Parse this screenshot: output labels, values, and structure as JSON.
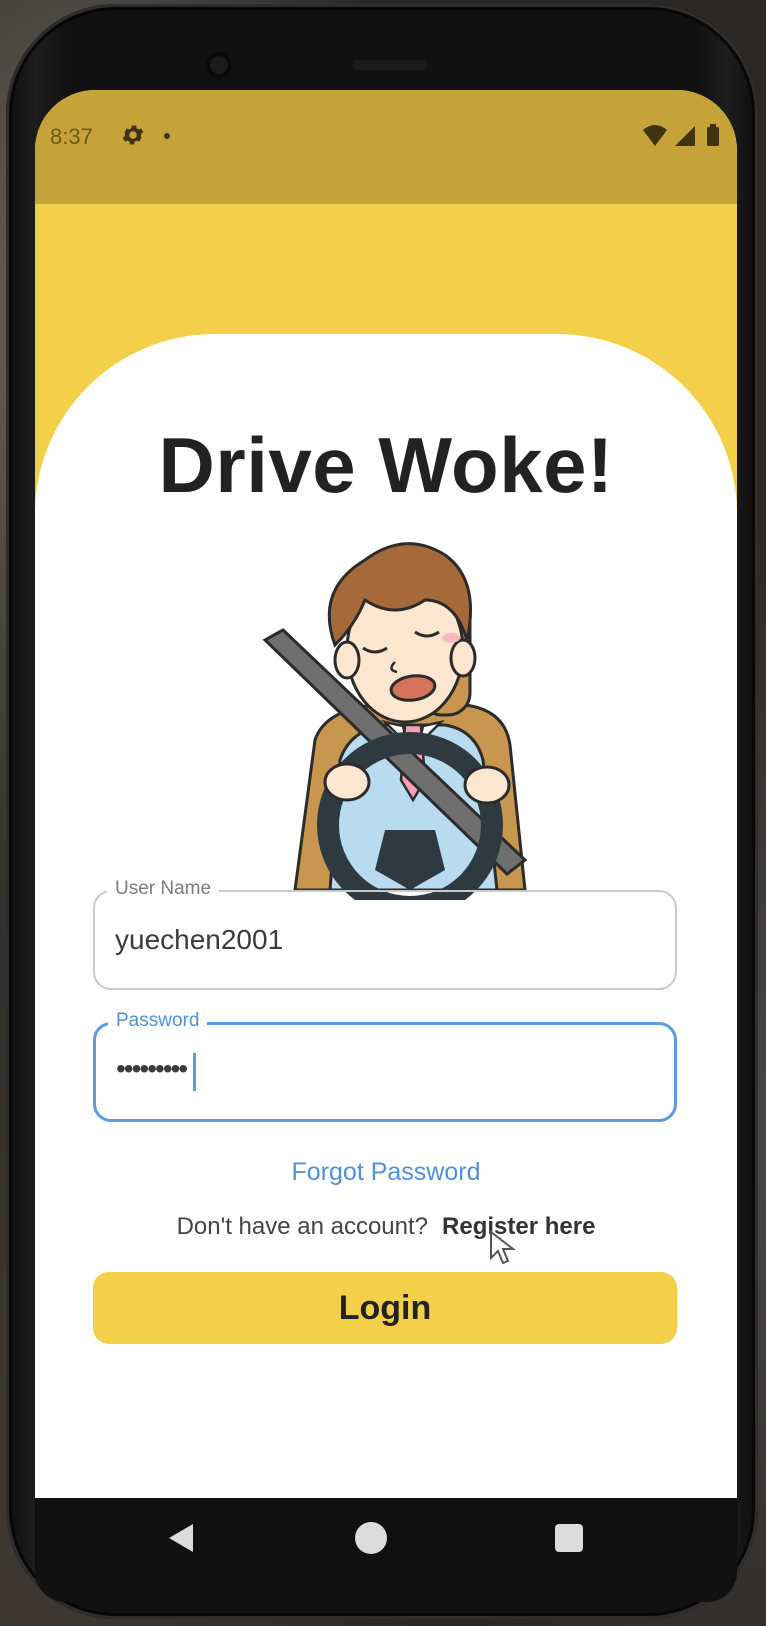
{
  "status_bar": {
    "time": "8:37",
    "icons": [
      "gear-icon",
      "notification-dot-icon",
      "wifi-icon",
      "signal-icon",
      "battery-icon"
    ]
  },
  "app": {
    "title": "Drive Woke!",
    "illustration": "drowsy-driver-illustration"
  },
  "form": {
    "username_label": "User Name",
    "username_value": "yuechen2001",
    "password_label": "Password",
    "password_value": "•••••••••",
    "forgot_password": "Forgot Password",
    "no_account_text": "Don't have an account?",
    "register_link": "Register here",
    "login_button": "Login"
  },
  "nav": {
    "buttons": [
      "back-icon",
      "home-icon",
      "recents-icon"
    ]
  },
  "colors": {
    "primary_yellow": "#f4cf4a",
    "status_bar": "#c6a338",
    "link_blue": "#4f91d8",
    "focus_border": "#5b9be0"
  }
}
